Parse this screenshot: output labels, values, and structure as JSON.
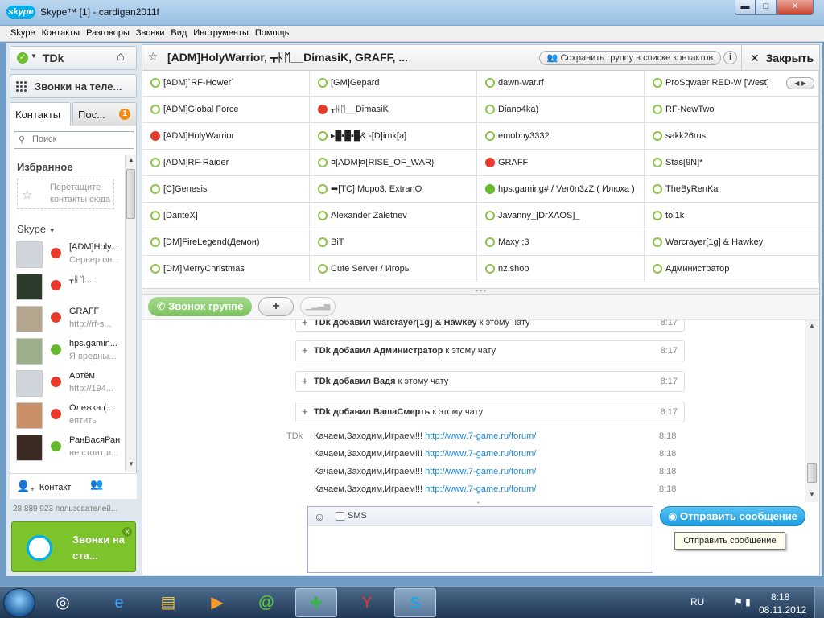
{
  "window": {
    "logo": "skype",
    "title": "Skype™ [1] - cardigan2011f",
    "min": "▬",
    "max": "□",
    "close": "✕"
  },
  "menu": [
    "Skype",
    "Контакты",
    "Разговоры",
    "Звонки",
    "Вид",
    "Инструменты",
    "Помощь"
  ],
  "user": {
    "name": "TDk",
    "status_color": "#66b82d",
    "home_icon": "home-icon"
  },
  "calls_label": "Звонки на теле...",
  "tabs": {
    "contacts": "Контакты",
    "recent": "Пос...",
    "recent_badge": "1"
  },
  "search": {
    "placeholder": "Поиск"
  },
  "favorites": {
    "heading": "Избранное",
    "hint": "Перетащите контакты сюда"
  },
  "skype_group": "Skype",
  "contacts": [
    {
      "name": "[ADM]Holy...",
      "mood": "Сервер он...",
      "status": "red"
    },
    {
      "name": "ᚁᚺᛖ...",
      "mood": "",
      "status": "red"
    },
    {
      "name": "GRAFF",
      "mood": "http://rf-s...",
      "status": "red"
    },
    {
      "name": "hps.gamin...",
      "mood": "Я вредны...",
      "status": "green"
    },
    {
      "name": "Артём",
      "mood": "http://194...",
      "status": "red"
    },
    {
      "name": "Олежка (...",
      "mood": "ептить",
      "status": "red"
    },
    {
      "name": "РанВасяРан",
      "mood": "не стоит и...",
      "status": "green"
    }
  ],
  "left_footer": {
    "add_contact": "Контакт",
    "users_online": "28 889 923 пользователей..."
  },
  "promo": {
    "text": "Звонки на ста..."
  },
  "conversation": {
    "title": "[ADM]HolyWarrior, ᚁᚺᛖ__DimasiK, GRAFF, ...",
    "save_group": "Сохранить группу в списке контактов",
    "info": "i",
    "close": "Закрыть"
  },
  "participants": [
    [
      {
        "n": "[ADM]`RF-Hower`",
        "s": "away"
      },
      {
        "n": "[GM]Gepard",
        "s": "away"
      },
      {
        "n": "dawn-war.rf",
        "s": "away"
      },
      {
        "n": "ProSqwaer RED-W [West]",
        "s": "away"
      }
    ],
    [
      {
        "n": "[ADM]Global Force",
        "s": "away"
      },
      {
        "n": "ᚁᚺᛖ__DimasiK",
        "s": "busy"
      },
      {
        "n": "Diano4ka)",
        "s": "away"
      },
      {
        "n": "RF-NewTwo",
        "s": "away"
      }
    ],
    [
      {
        "n": "[ADM]HolyWarrior",
        "s": "busy"
      },
      {
        "n": "▸█▪█▪█& -[D]imk[a]",
        "s": "away"
      },
      {
        "n": "emoboy3332",
        "s": "away"
      },
      {
        "n": "sakk26rus",
        "s": "away"
      }
    ],
    [
      {
        "n": "[ADM]RF-Raider",
        "s": "away"
      },
      {
        "n": "¤[ADM]¤{RISE_OF_WAR}",
        "s": "away"
      },
      {
        "n": "GRAFF",
        "s": "busy"
      },
      {
        "n": "Stas[9N]*",
        "s": "away"
      }
    ],
    [
      {
        "n": "[C]Genesis",
        "s": "away"
      },
      {
        "n": "➡[TC] Mopo3, ExtranO",
        "s": "away"
      },
      {
        "n": "hps.gaming# / Ver0n3zZ ( Илюха )",
        "s": "ok"
      },
      {
        "n": "TheByRenKa",
        "s": "away"
      }
    ],
    [
      {
        "n": "[DanteX]",
        "s": "away"
      },
      {
        "n": "Alexander Zaletnev",
        "s": "away"
      },
      {
        "n": "Javanny_[DrXAOS]_",
        "s": "away"
      },
      {
        "n": "tol1k",
        "s": "away"
      }
    ],
    [
      {
        "n": "[DM]FireLegend(Демон)",
        "s": "away"
      },
      {
        "n": "BiT",
        "s": "away"
      },
      {
        "n": "Maxy ;3",
        "s": "away"
      },
      {
        "n": "Warcrayer[1g] & Hawkey",
        "s": "away"
      }
    ],
    [
      {
        "n": "[DM]MerryChristmas",
        "s": "away"
      },
      {
        "n": "Cute Server / Игорь",
        "s": "away"
      },
      {
        "n": "nz.shop",
        "s": "away"
      },
      {
        "n": "Администратор",
        "s": "away"
      }
    ]
  ],
  "callbar": {
    "call_group": "Звонок группе",
    "add": "+",
    "signal": "▁▂▃▅"
  },
  "system_messages": [
    {
      "text_pre": "TDk добавил ",
      "who": "Warcrayer[1g] & Hawkey",
      "text_post": " к этому чату",
      "time": "8:17"
    },
    {
      "text_pre": "TDk добавил ",
      "who": "Администратор",
      "text_post": " к этому чату",
      "time": "8:17"
    },
    {
      "text_pre": "TDk добавил ",
      "who": "Вадя",
      "text_post": " к этому чату",
      "time": "8:17"
    },
    {
      "text_pre": "TDk добавил ",
      "who": "ВашаСмерть",
      "text_post": " к этому чату",
      "time": "8:17"
    }
  ],
  "chat_messages": [
    {
      "sender": "TDk",
      "text": "Качаем,Заходим,Играем!!! ",
      "link": "http://www.7-game.ru/forum/",
      "time": "8:18"
    },
    {
      "sender": "",
      "text": "Качаем,Заходим,Играем!!! ",
      "link": "http://www.7-game.ru/forum/",
      "time": "8:18"
    },
    {
      "sender": "",
      "text": "Качаем,Заходим,Играем!!! ",
      "link": "http://www.7-game.ru/forum/",
      "time": "8:18"
    },
    {
      "sender": "",
      "text": "Качаем,Заходим,Играем!!! ",
      "link": "http://www.7-game.ru/forum/",
      "time": "8:18"
    }
  ],
  "composer": {
    "sms_label": "SMS",
    "send": "Отправить сообщение",
    "tooltip": "Отправить сообщение"
  },
  "taskbar": {
    "apps": [
      "start-orb",
      "chrome-icon",
      "ie-icon",
      "explorer-icon",
      "media-player-icon",
      "mail-agent-icon",
      "minimized-app-icon",
      "yandex-icon",
      "skype-icon"
    ],
    "lang": "RU",
    "time": "8:18",
    "date": "08.11.2012"
  }
}
